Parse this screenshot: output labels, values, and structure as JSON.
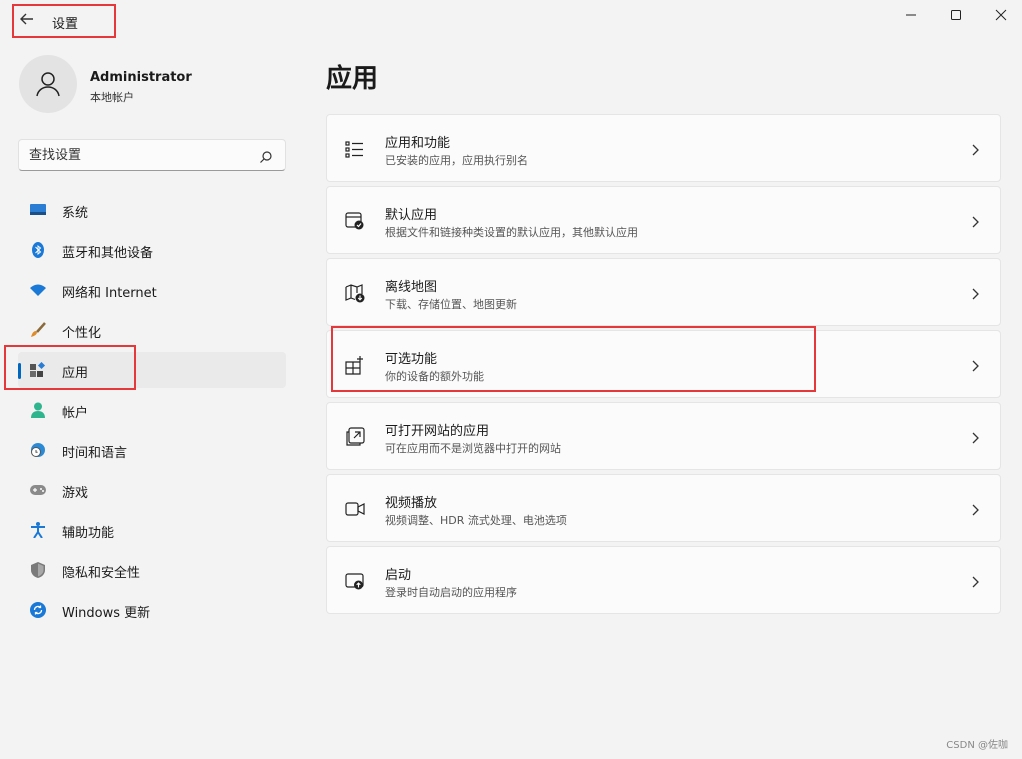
{
  "window": {
    "title": "设置"
  },
  "profile": {
    "name": "Administrator",
    "account_type": "本地帐户"
  },
  "search": {
    "placeholder": "查找设置"
  },
  "nav": {
    "items": [
      {
        "label": "系统",
        "icon": "monitor-icon"
      },
      {
        "label": "蓝牙和其他设备",
        "icon": "bluetooth-icon"
      },
      {
        "label": "网络和 Internet",
        "icon": "wifi-icon"
      },
      {
        "label": "个性化",
        "icon": "brush-icon"
      },
      {
        "label": "应用",
        "icon": "apps-icon",
        "active": true
      },
      {
        "label": "帐户",
        "icon": "person-icon"
      },
      {
        "label": "时间和语言",
        "icon": "globe-clock-icon"
      },
      {
        "label": "游戏",
        "icon": "gamepad-icon"
      },
      {
        "label": "辅助功能",
        "icon": "accessibility-icon"
      },
      {
        "label": "隐私和安全性",
        "icon": "shield-icon"
      },
      {
        "label": "Windows 更新",
        "icon": "update-icon"
      }
    ]
  },
  "main": {
    "title": "应用",
    "cards": [
      {
        "title": "应用和功能",
        "subtitle": "已安装的应用，应用执行别名",
        "icon": "list-icon"
      },
      {
        "title": "默认应用",
        "subtitle": "根据文件和链接种类设置的默认应用，其他默认应用",
        "icon": "default-app-icon"
      },
      {
        "title": "离线地图",
        "subtitle": "下载、存储位置、地图更新",
        "icon": "map-icon"
      },
      {
        "title": "可选功能",
        "subtitle": "你的设备的额外功能",
        "icon": "add-feature-icon"
      },
      {
        "title": "可打开网站的应用",
        "subtitle": "可在应用而不是浏览器中打开的网站",
        "icon": "open-external-icon"
      },
      {
        "title": "视频播放",
        "subtitle": "视频调整、HDR 流式处理、电池选项",
        "icon": "video-icon"
      },
      {
        "title": "启动",
        "subtitle": "登录时自动启动的应用程序",
        "icon": "startup-icon"
      }
    ]
  },
  "watermark": "CSDN @佐咖",
  "colors": {
    "accent": "#0067c0",
    "highlight": "#e5383b",
    "background": "#f3f3f3",
    "card": "#fbfbfb"
  }
}
